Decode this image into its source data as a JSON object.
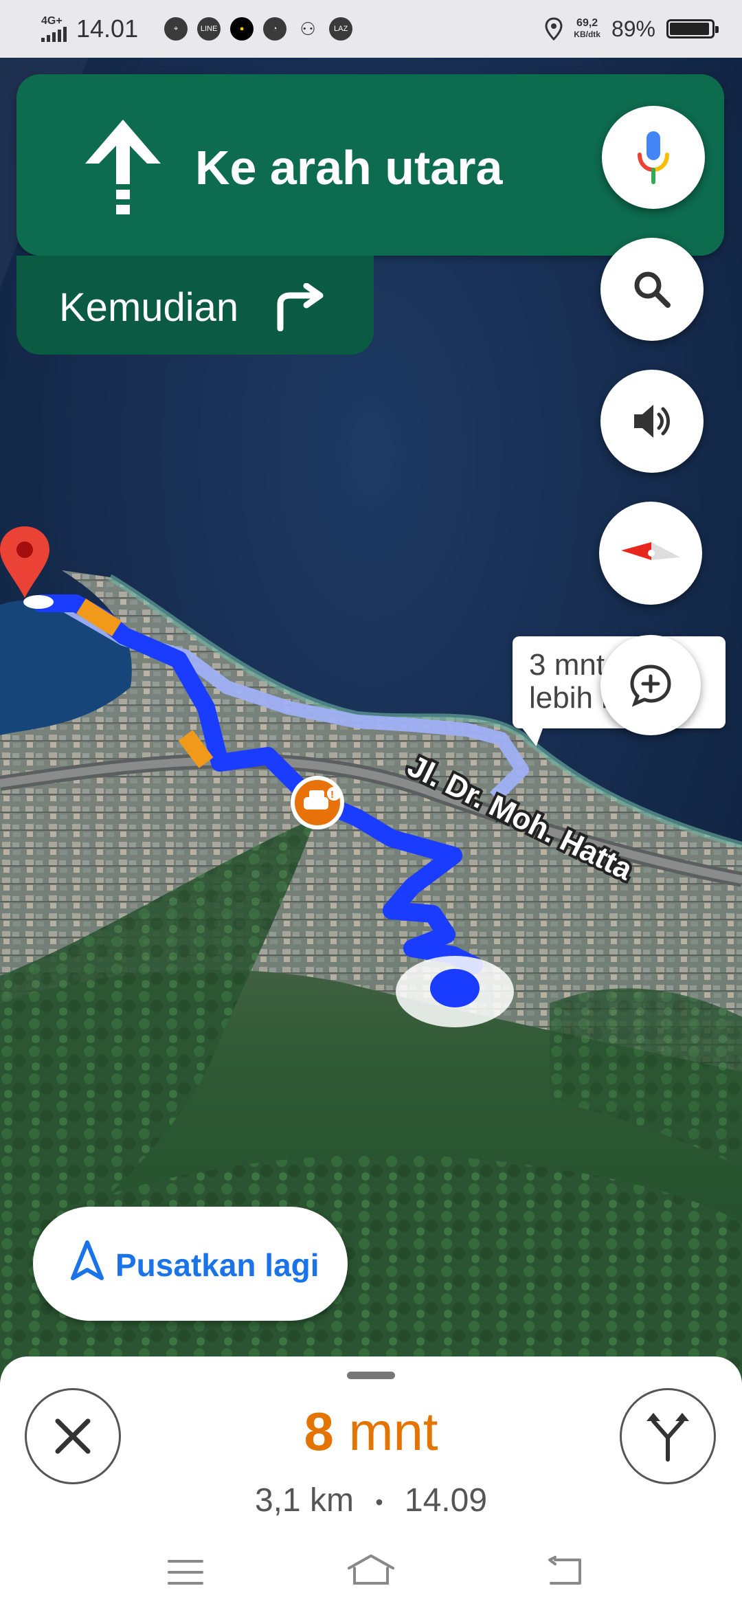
{
  "status_bar": {
    "network": "4G+",
    "time": "14.01",
    "app_icons": [
      "maps-app-icon",
      "line-app-icon",
      "circle-app-icon",
      "gauge-app-icon",
      "person-add-icon",
      "laz-app-icon"
    ],
    "laz_label": "LAZ",
    "line_label": "LINE",
    "speed_value": "69,2",
    "speed_unit": "KB/dtk",
    "battery_percent": "89%",
    "battery_level": 0.89
  },
  "navigation": {
    "instruction": "Ke arah utara",
    "then_label": "Kemudian",
    "then_icon": "turn-right-icon"
  },
  "map": {
    "street_label": "Jl. Dr. Moh. Hatta",
    "alt_route_callout_line1": "3 mnt",
    "alt_route_callout_line2": "lebih lambat"
  },
  "buttons": {
    "recenter_label": "Pusatkan lagi"
  },
  "trip": {
    "eta_value": "8",
    "eta_unit": "mnt",
    "distance": "3,1 km",
    "separator": "•",
    "arrival_time": "14.09"
  },
  "colors": {
    "nav_green": "#0d6b4e",
    "nav_green_dark": "#0b5b42",
    "route_blue": "#1a3cff",
    "eta_orange": "#e37400",
    "accent_blue": "#1a73e8"
  }
}
